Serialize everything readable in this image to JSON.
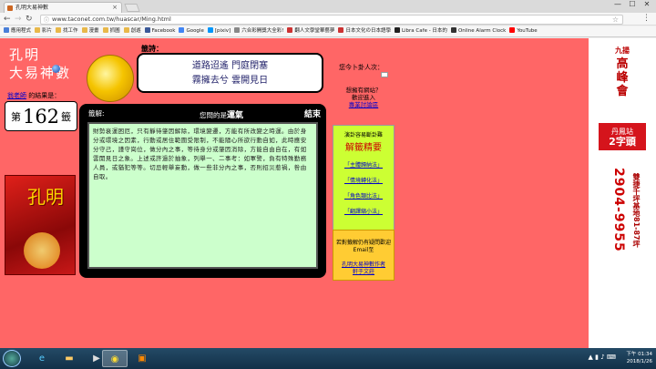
{
  "browser": {
    "tab_title": "孔明大易神數",
    "url": "www.taconet.com.tw/huascar/Ming.html",
    "window_controls": [
      "—",
      "☐",
      "✕"
    ]
  },
  "bookmarks": [
    {
      "label": "應用程式",
      "color": "#4a7fd8"
    },
    {
      "label": "影片",
      "color": "#e8b84a"
    },
    {
      "label": "找工作",
      "color": "#e8b84a"
    },
    {
      "label": "漫畫",
      "color": "#e8b84a"
    },
    {
      "label": "抓圖",
      "color": "#e8b84a"
    },
    {
      "label": "創遊",
      "color": "#e8b84a"
    },
    {
      "label": "Facebook",
      "color": "#3b5998"
    },
    {
      "label": "Google",
      "color": "#4285f4"
    },
    {
      "label": "[pixiv]",
      "color": "#0096fa"
    },
    {
      "label": "六合彩開獎大全彩!",
      "color": "#888888"
    },
    {
      "label": "翻人文學堂華藝夢",
      "color": "#c33"
    },
    {
      "label": "日本文化の日本語學",
      "color": "#c33"
    },
    {
      "label": "Libra Cafe - 日本的",
      "color": "#222"
    },
    {
      "label": "Online Alarm Clock",
      "color": "#333"
    },
    {
      "label": "YouTube",
      "color": "#f00"
    }
  ],
  "page": {
    "brand_line1": "孔明",
    "brand_line2": "大易神數",
    "user_name": "翁老師",
    "result_suffix": "的結果是：",
    "lot_prefix": "第",
    "lot_number": "162",
    "lot_suffix": "籤",
    "poem_label": "籤詩：",
    "poem_line1": "道路迢遙  門庭閉塞",
    "poem_line2": "霧擁去兮  雲開見日",
    "visitors_label": "您今卜卦人次：",
    "welcome_line1": "想擁有網站？",
    "welcome_line2": "歡迎進入",
    "welcome_link": "專業討論區",
    "interp_label": "籤解:",
    "interp_question_prefix": "您問的是",
    "interp_question_topic": "運氣",
    "interp_end": "結束",
    "interp_text": "財勢衰運困厄，只有靜待肇因解除，環境變遷，方能有所改變之時運。由於身分或環境之因素，行動或居住範圍受限制，不能隨心所欲行動自如，此時應安分守己，謹守崗位，做分內之事，等待身分或肇因消除，方能自由自在，有如雲開見日之象。上述或許過於抽象，列舉一、二事考：如軍警，負有特殊勤務人員，或猶犯等等。切忌輕舉妄動，做一些非分內之事，否則招災惹禍，咎由自取。",
    "green_tip": "演卦容易斷卦難",
    "green_title": "解籤精要",
    "green_links": [
      "「主體歸納法」",
      "「情境轉化法」",
      "「角色類比法」",
      "「翻譯縮小法」"
    ],
    "yellow_text": "若對籤解仍有疑問歡迎Email至",
    "yellow_link_line1": "孔明大易神數作者",
    "yellow_link_line2": "軒于文莊"
  },
  "ad": {
    "line1": "九揚",
    "line2": "高",
    "line3": "峰",
    "line4": "會",
    "badge_line1": "丹鳳站",
    "badge_line2": "2字頭",
    "phone": "2904-9955",
    "side_text": "雙捷千坪基地81-87坪"
  },
  "taskbar": {
    "time": "下午 01:34",
    "date": "2018/1/26"
  }
}
